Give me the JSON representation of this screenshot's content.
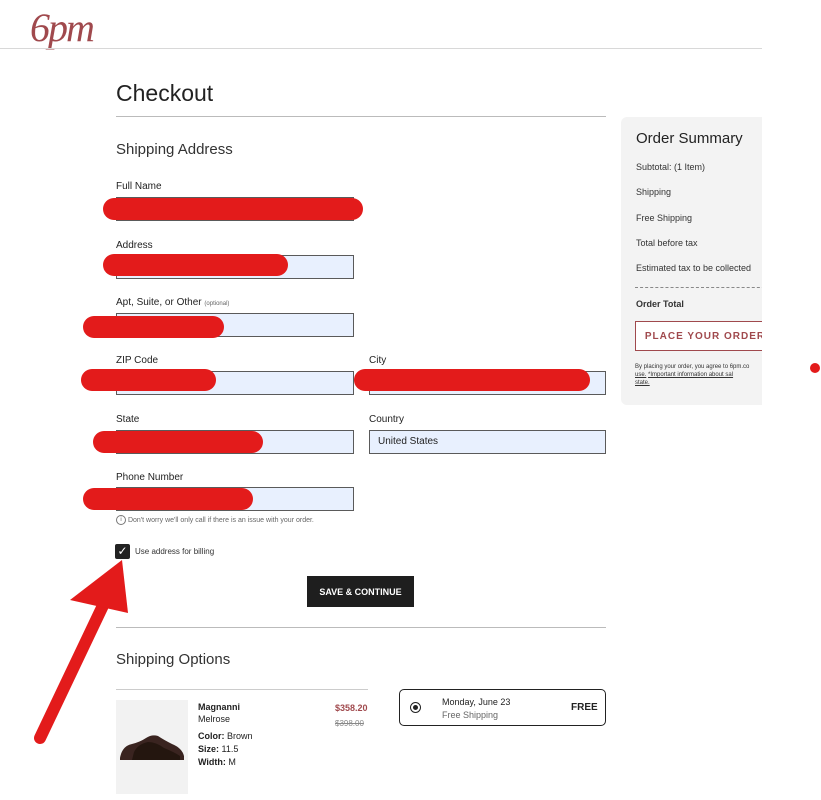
{
  "brand": {
    "logo_text": "6pm",
    "color": "#a0494d"
  },
  "page_title": "Checkout",
  "shipping_address": {
    "title": "Shipping Address",
    "full_name_label": "Full Name",
    "address_label": "Address",
    "apt_label": "Apt, Suite, or Other",
    "apt_optional": "(optional)",
    "zip_label": "ZIP Code",
    "city_label": "City",
    "state_label": "State",
    "country_label": "Country",
    "country_value": "United States",
    "phone_label": "Phone Number",
    "phone_hint": "Don't worry we'll only call if there is an issue with your order.",
    "billing_checkbox_label": "Use address for billing",
    "billing_checked": true,
    "save_button": "SAVE & CONTINUE"
  },
  "shipping_options": {
    "title": "Shipping Options",
    "product": {
      "brand": "Magnanni",
      "name": "Melrose",
      "color_label": "Color:",
      "color_value": "Brown",
      "size_label": "Size:",
      "size_value": "11.5",
      "width_label": "Width:",
      "width_value": "M",
      "price": "$358.20",
      "original_price": "$398.00"
    },
    "option": {
      "date": "Monday, June 23",
      "method": "Free Shipping",
      "cost": "FREE",
      "selected": true
    }
  },
  "order_summary": {
    "title": "Order Summary",
    "subtotal": "Subtotal: (1 Item)",
    "shipping": "Shipping",
    "free_shipping": "Free Shipping",
    "total_before_tax": "Total before tax",
    "estimated_tax": "Estimated tax to be collected",
    "order_total": "Order Total",
    "place_button": "PLACE YOUR ORDER",
    "legal_prefix": "By placing your order, you agree to 6pm.co",
    "legal_use": "use.",
    "legal_link": "*Important information about sal",
    "legal_suffix": "state."
  }
}
